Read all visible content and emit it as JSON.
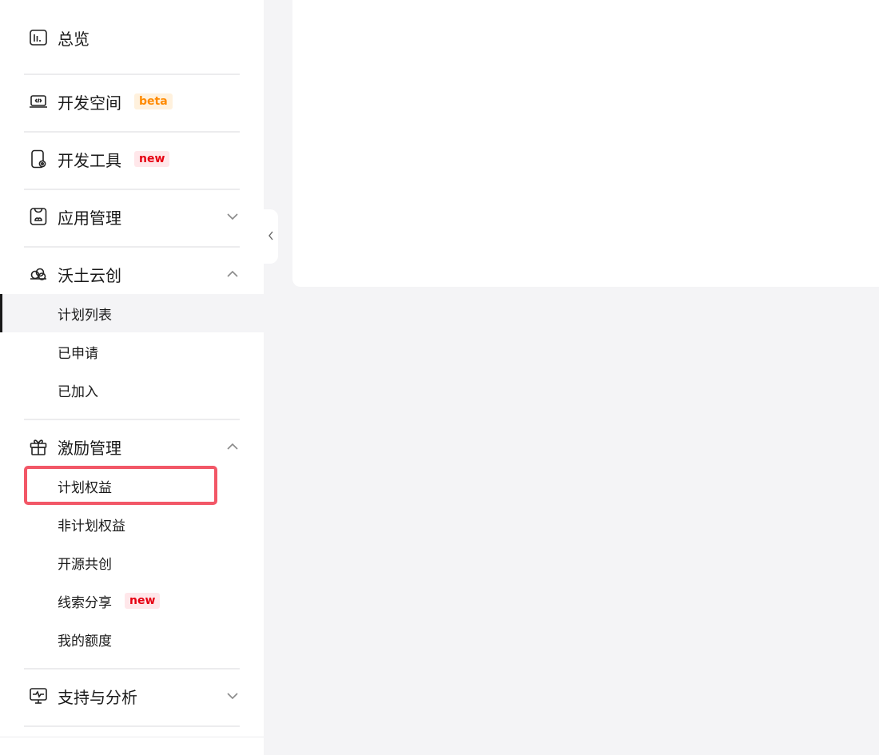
{
  "sidebar": {
    "groups": [
      {
        "label": "总览",
        "icon": "chart-overview-icon"
      },
      {
        "label": "开发空间",
        "icon": "laptop-code-icon",
        "badge": "beta"
      },
      {
        "label": "开发工具",
        "icon": "device-tool-icon",
        "badge": "new"
      },
      {
        "label": "应用管理",
        "icon": "app-bag-icon",
        "expanded": false
      },
      {
        "label": "沃土云创",
        "icon": "cloud-icon",
        "expanded": true,
        "items": [
          {
            "label": "计划列表",
            "active": true
          },
          {
            "label": "已申请"
          },
          {
            "label": "已加入"
          }
        ]
      },
      {
        "label": "激励管理",
        "icon": "gift-icon",
        "expanded": true,
        "items": [
          {
            "label": "计划权益",
            "highlighted": true
          },
          {
            "label": "非计划权益"
          },
          {
            "label": "开源共创"
          },
          {
            "label": "线索分享",
            "badge": "new"
          },
          {
            "label": "我的额度"
          }
        ]
      },
      {
        "label": "支持与分析",
        "icon": "monitor-pulse-icon",
        "expanded": false
      }
    ]
  },
  "colors": {
    "badge_beta_bg": "#fff1dd",
    "badge_beta_text": "#ff8a00",
    "badge_new_bg": "#ffe7ea",
    "badge_new_text": "#e60012",
    "highlight": "#f25767",
    "active_indicator": "#191919"
  }
}
